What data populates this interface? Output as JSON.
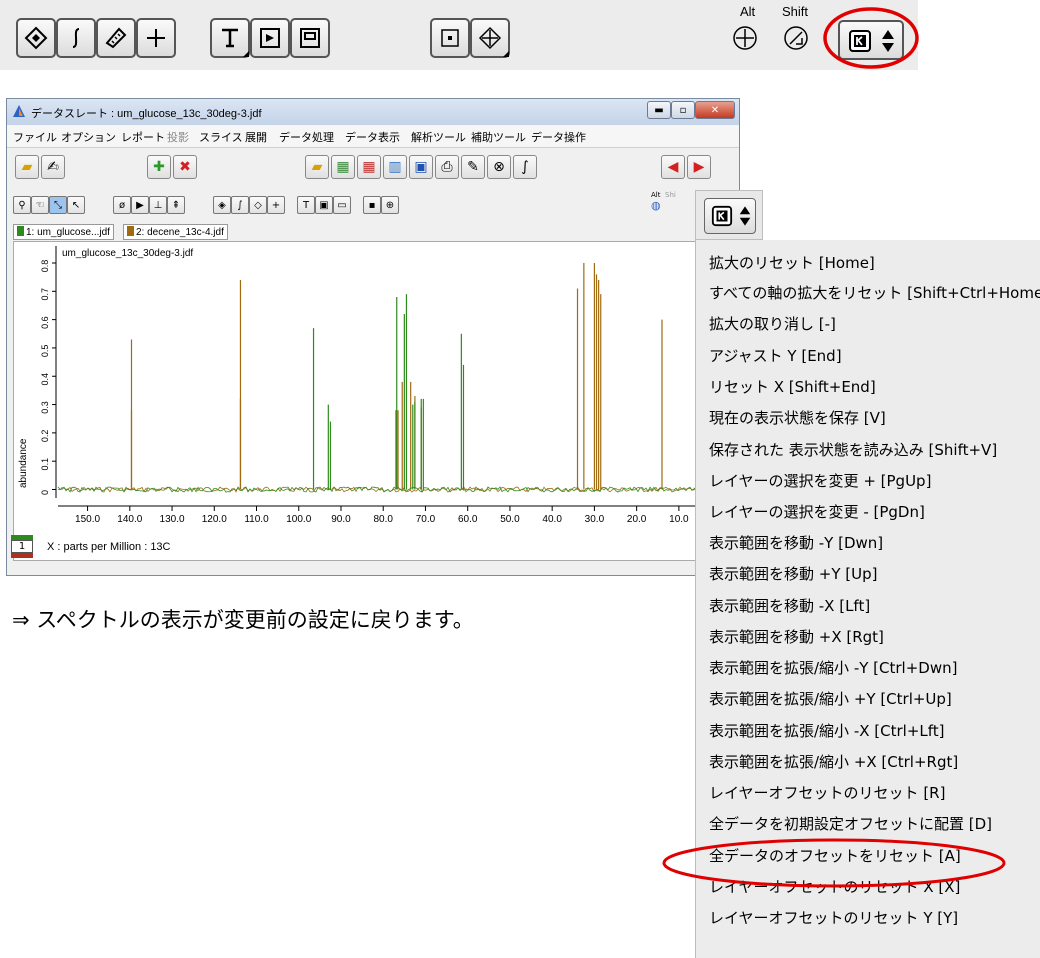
{
  "top_toolbar": {
    "alt_label": "Alt",
    "shift_label": "Shift"
  },
  "window": {
    "title": "データスレート : um_glucose_13c_30deg-3.jdf",
    "menu": [
      "ファイル",
      "オプション",
      "レポート",
      "投影",
      "スライス",
      "展開",
      "データ処理",
      "データ表示",
      "解析ツール",
      "補助ツール",
      "データ操作"
    ],
    "tabs": [
      "1: um_glucose...jdf",
      "2: decene_13c-4.jdf"
    ],
    "plot_title": "um_glucose_13c_30deg-3.jdf",
    "y_axis_label": "abundance",
    "x_axis_label": "X : parts per Million : 13C",
    "layer_index": "1",
    "alt_small": "Alt",
    "shift_small": "Shi"
  },
  "chart_data": {
    "type": "line",
    "xlabel": "X : parts per Million : 13C",
    "ylabel": "abundance",
    "x_ticks": [
      "150.0",
      "140.0",
      "130.0",
      "120.0",
      "110.0",
      "100.0",
      "90.0",
      "80.0",
      "70.0",
      "60.0",
      "50.0",
      "40.0",
      "30.0",
      "20.0",
      "10.0"
    ],
    "y_ticks": [
      "0",
      "0.1",
      "0.2",
      "0.3",
      "0.4",
      "0.5",
      "0.6",
      "0.7",
      "0.8"
    ],
    "xlim": [
      157,
      5
    ],
    "ylim": [
      -0.03,
      0.86
    ],
    "series": [
      {
        "color": "#a06a10",
        "peaks": [
          [
            139.6,
            0.53
          ],
          [
            139.6,
            0.28
          ],
          [
            113.8,
            0.74
          ],
          [
            113.8,
            0.32
          ],
          [
            77.0,
            0.28
          ],
          [
            76.5,
            0.28
          ],
          [
            75.5,
            0.38
          ],
          [
            73.5,
            0.38
          ],
          [
            72.5,
            0.33
          ],
          [
            71.0,
            0.29
          ],
          [
            34.0,
            0.71
          ],
          [
            32.5,
            0.8
          ],
          [
            30.0,
            0.8
          ],
          [
            29.5,
            0.76
          ],
          [
            29.0,
            0.74
          ],
          [
            28.5,
            0.69
          ],
          [
            14.0,
            0.6
          ]
        ]
      },
      {
        "color": "#2f8a1e",
        "peaks": [
          [
            96.5,
            0.57
          ],
          [
            93.0,
            0.3
          ],
          [
            92.5,
            0.24
          ],
          [
            76.8,
            0.68
          ],
          [
            75.0,
            0.62
          ],
          [
            74.5,
            0.69
          ],
          [
            73.0,
            0.3
          ],
          [
            72.5,
            0.31
          ],
          [
            71.0,
            0.32
          ],
          [
            70.5,
            0.32
          ],
          [
            61.5,
            0.55
          ],
          [
            61.0,
            0.44
          ]
        ]
      }
    ]
  },
  "menu_items": [
    "拡大のリセット [Home]",
    "すべての軸の拡大をリセット [Shift+Ctrl+Home]",
    "拡大の取り消し [-]",
    "アジャスト Y [End]",
    "リセット X [Shift+End]",
    "現在の表示状態を保存 [V]",
    "保存された 表示状態を読み込み [Shift+V]",
    "レイヤーの選択を変更 + [PgUp]",
    "レイヤーの選択を変更 - [PgDn]",
    "表示範囲を移動 -Y [Dwn]",
    "表示範囲を移動 +Y [Up]",
    "表示範囲を移動 -X [Lft]",
    "表示範囲を移動 +X [Rgt]",
    "表示範囲を拡張/縮小 -Y [Ctrl+Dwn]",
    "表示範囲を拡張/縮小 +Y [Ctrl+Up]",
    "表示範囲を拡張/縮小 -X [Ctrl+Lft]",
    "表示範囲を拡張/縮小 +X [Ctrl+Rgt]",
    "レイヤーオフセットのリセット [R]",
    "全データを初期設定オフセットに配置 [D]",
    "全データのオフセットをリセット [A]",
    "レイヤーオフセットのリセット X [X]",
    "レイヤーオフセットのリセット Y [Y]"
  ],
  "note": "⇒ スペクトルの表示が変更前の設定に戻ります。",
  "highlight_color": "#e00000"
}
